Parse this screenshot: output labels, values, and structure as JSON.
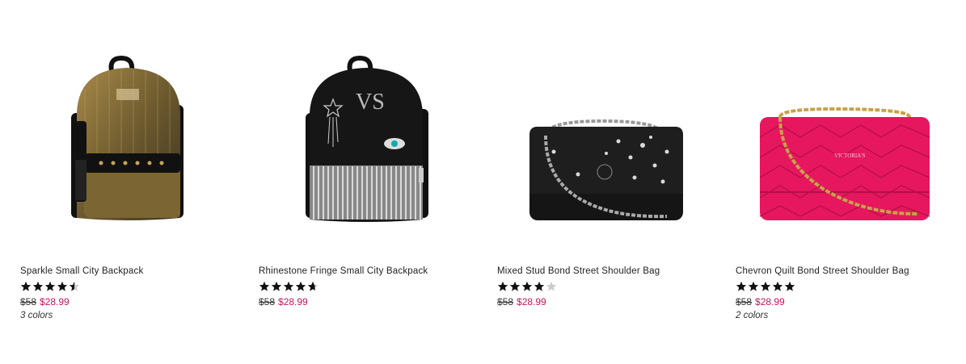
{
  "products": [
    {
      "name": "Sparkle Small City Backpack",
      "rating": 4.5,
      "old_price": "$58",
      "sale_price": "$28.99",
      "colors": "3 colors",
      "image_icon": "gold-sparkle-backpack-image"
    },
    {
      "name": "Rhinestone Fringe Small City Backpack",
      "rating": 4.7,
      "old_price": "$58",
      "sale_price": "$28.99",
      "colors": "",
      "image_icon": "black-rhinestone-backpack-image"
    },
    {
      "name": "Mixed Stud Bond Street Shoulder Bag",
      "rating": 4.0,
      "old_price": "$58",
      "sale_price": "$28.99",
      "colors": "",
      "image_icon": "black-stud-shoulder-bag-image"
    },
    {
      "name": "Chevron Quilt Bond Street Shoulder Bag",
      "rating": 5.0,
      "old_price": "$58",
      "sale_price": "$28.99",
      "colors": "2 colors",
      "image_icon": "pink-chevron-shoulder-bag-image"
    }
  ],
  "colors": {
    "sale": "#c2185b",
    "star_filled": "#111111",
    "star_empty": "#cccccc"
  }
}
